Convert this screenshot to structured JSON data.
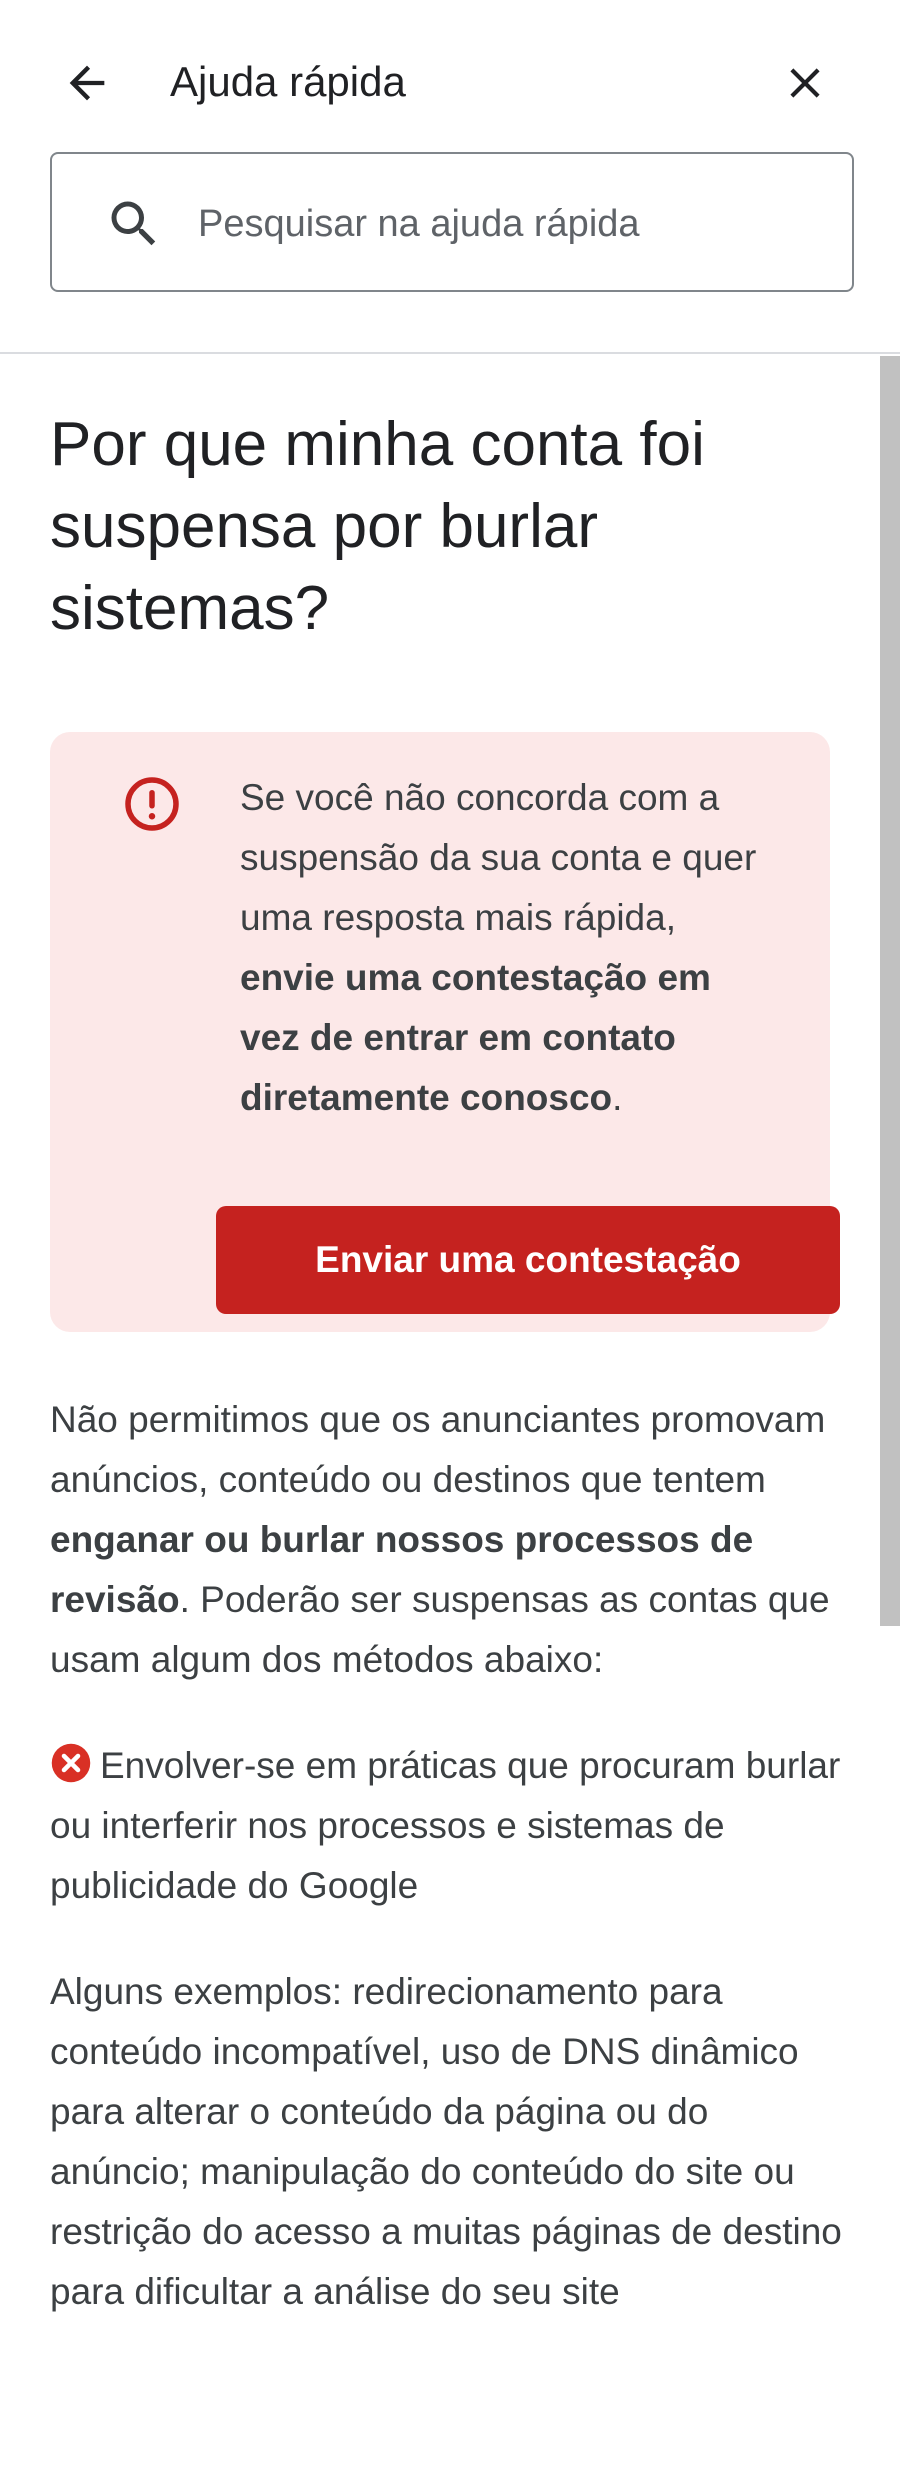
{
  "header": {
    "title": "Ajuda rápida",
    "back_icon": "arrow-back-icon",
    "close_icon": "close-icon"
  },
  "search": {
    "placeholder": "Pesquisar na ajuda rápida",
    "value": "",
    "icon": "search-icon"
  },
  "article": {
    "title": "Por que minha conta foi suspensa por burlar sistemas?",
    "callout": {
      "icon": "error-icon",
      "text_plain": "Se você não concorda com a suspensão da sua conta e quer uma resposta mais rápida, ",
      "text_bold": "envie uma contestação em vez de entrar em contato diretamente conosco",
      "text_end": ".",
      "button_label": "Enviar uma contestação"
    },
    "intro": {
      "part1": "Não permitimos que os anunciantes promovam anúncios, conteúdo ou destinos que tentem ",
      "bold": "enganar ou burlar nossos processos de revisão",
      "part2": ". Poderão ser suspensas as contas que usam algum dos métodos abaixo:"
    },
    "bullet": {
      "icon": "cancel-x-icon",
      "text": "Envolver-se em práticas que procuram burlar ou interferir nos processos e sistemas de publicidade do Google"
    },
    "examples": "Alguns exemplos: redirecionamento para conteúdo incompatível, uso de DNS dinâmico para alterar o conteúdo da página ou do anúncio; manipulação do conteúdo do site ou restrição do acesso a muitas páginas de destino para dificultar a análise do seu site"
  },
  "colors": {
    "accent_red": "#c5221f",
    "callout_bg": "#fce8e8",
    "text": "#202124",
    "muted_text": "#3c4043",
    "border": "#80868b"
  }
}
